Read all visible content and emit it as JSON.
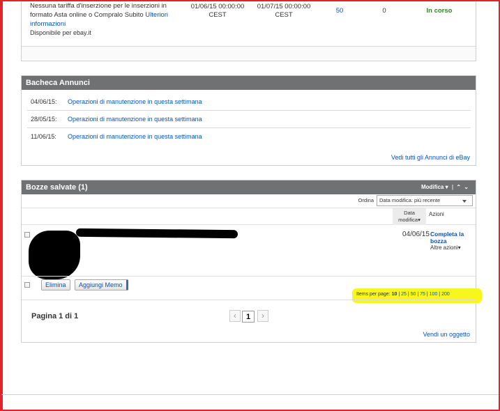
{
  "top_listing": {
    "description_lines": [
      "Nessuna tariffa d'inserzione per le inserzioni in",
      "formato Asta online o Compralo Subito"
    ],
    "more_info_link": "Ulteriori informazioni",
    "availability": "Disponibile per ebay.it",
    "start_date": "01/06/15 00:00:00",
    "start_tz": "CEST",
    "end_date": "01/07/15 00:00:00",
    "end_tz": "CEST",
    "count_link": "50",
    "count_used": "0",
    "status": "In corso",
    "status_color": "#2e8a1f"
  },
  "bacheca": {
    "title": "Bacheca Annunci",
    "items": [
      {
        "date": "04/06/15:",
        "text": "Operazioni di manutenzione in questa settimana"
      },
      {
        "date": "28/05/15:",
        "text": "Operazioni di manutenzione in questa settimana"
      },
      {
        "date": "11/06/15:",
        "text": "Operazioni di manutenzione in questa settimana"
      }
    ],
    "see_all": "Vedi tutti gli Annunci di eBay"
  },
  "bozze": {
    "title": "Bozze salvate (1)",
    "header_action": "Modifica",
    "sort_label": "Ordina",
    "sort_selected": "Data modifica: più recente",
    "col_date_line1": "Data",
    "col_date_line2": "modifica",
    "col_actions": "Azioni",
    "row": {
      "date": "04/06/15",
      "complete_link_1": "Completa la",
      "complete_link_2": "bozza",
      "more_actions": "Altre azioni"
    },
    "delete_button": "Elimina",
    "memo_button": "Aggiungi Memo",
    "items_per_page_label": "Items per page:",
    "items_per_page_options": [
      "10",
      "25",
      "50",
      "75",
      "100",
      "200"
    ],
    "items_per_page_selected": "10",
    "pagination_text": "Pagina 1 di 1",
    "current_page": "1",
    "sell_link": "Vendi un oggetto"
  },
  "colors": {
    "link": "#0654ba",
    "panel_header": "#6f7173",
    "highlight": "#f7f71d",
    "frame": "#e0242a"
  }
}
